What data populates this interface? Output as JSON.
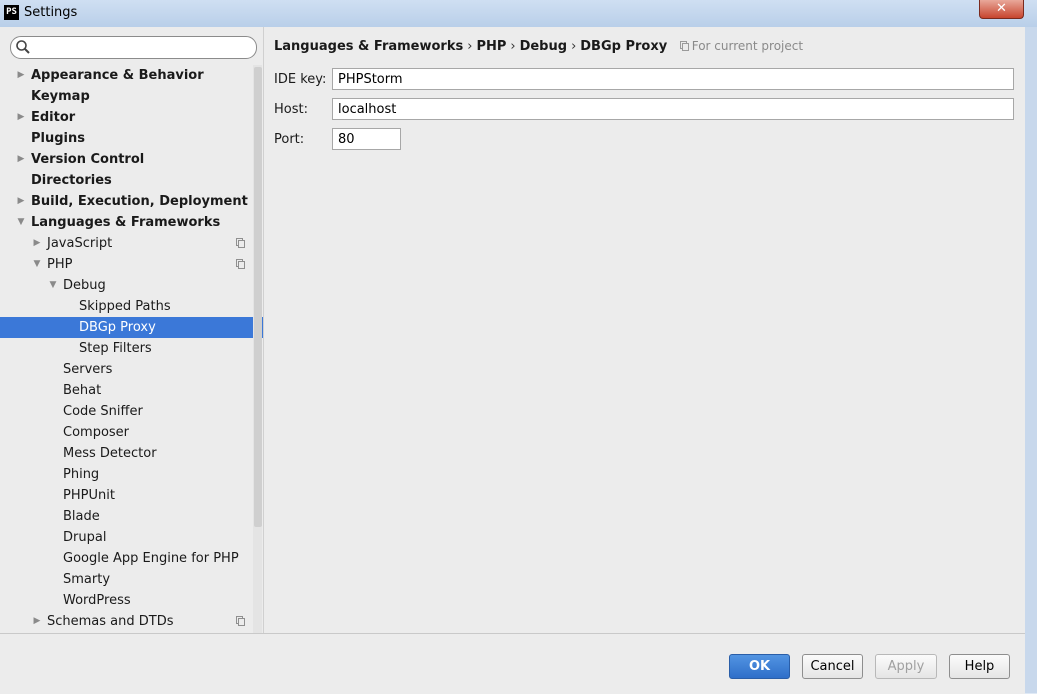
{
  "window": {
    "title": "Settings",
    "app_icon_text": "PS",
    "close_glyph": "✕"
  },
  "search": {
    "value": "",
    "placeholder": ""
  },
  "tree": [
    {
      "label": "Appearance & Behavior",
      "level": 0,
      "bold": true,
      "arrow": "right"
    },
    {
      "label": "Keymap",
      "level": 0,
      "bold": true,
      "arrow": ""
    },
    {
      "label": "Editor",
      "level": 0,
      "bold": true,
      "arrow": "right"
    },
    {
      "label": "Plugins",
      "level": 0,
      "bold": true,
      "arrow": ""
    },
    {
      "label": "Version Control",
      "level": 0,
      "bold": true,
      "arrow": "right"
    },
    {
      "label": "Directories",
      "level": 0,
      "bold": true,
      "arrow": ""
    },
    {
      "label": "Build, Execution, Deployment",
      "level": 0,
      "bold": true,
      "arrow": "right"
    },
    {
      "label": "Languages & Frameworks",
      "level": 0,
      "bold": true,
      "arrow": "down"
    },
    {
      "label": "JavaScript",
      "level": 1,
      "arrow": "right",
      "project": true
    },
    {
      "label": "PHP",
      "level": 1,
      "arrow": "down",
      "project": true
    },
    {
      "label": "Debug",
      "level": 2,
      "arrow": "down"
    },
    {
      "label": "Skipped Paths",
      "level": 3,
      "arrow": ""
    },
    {
      "label": "DBGp Proxy",
      "level": 3,
      "arrow": "",
      "selected": true
    },
    {
      "label": "Step Filters",
      "level": 3,
      "arrow": ""
    },
    {
      "label": "Servers",
      "level": 2,
      "arrow": ""
    },
    {
      "label": "Behat",
      "level": 2,
      "arrow": ""
    },
    {
      "label": "Code Sniffer",
      "level": 2,
      "arrow": ""
    },
    {
      "label": "Composer",
      "level": 2,
      "arrow": ""
    },
    {
      "label": "Mess Detector",
      "level": 2,
      "arrow": ""
    },
    {
      "label": "Phing",
      "level": 2,
      "arrow": ""
    },
    {
      "label": "PHPUnit",
      "level": 2,
      "arrow": ""
    },
    {
      "label": "Blade",
      "level": 2,
      "arrow": ""
    },
    {
      "label": "Drupal",
      "level": 2,
      "arrow": ""
    },
    {
      "label": "Google App Engine for PHP",
      "level": 2,
      "arrow": ""
    },
    {
      "label": "Smarty",
      "level": 2,
      "arrow": ""
    },
    {
      "label": "WordPress",
      "level": 2,
      "arrow": ""
    },
    {
      "label": "Schemas and DTDs",
      "level": 1,
      "arrow": "right",
      "project": true
    }
  ],
  "breadcrumb": {
    "items": [
      "Languages & Frameworks",
      "PHP",
      "Debug",
      "DBGp Proxy"
    ],
    "separator": "›",
    "scope": "For current project"
  },
  "form": {
    "ide_key": {
      "label": "IDE key:",
      "value": "PHPStorm"
    },
    "host": {
      "label": "Host:",
      "value": "localhost"
    },
    "port": {
      "label": "Port:",
      "value": "80"
    }
  },
  "buttons": {
    "ok": "OK",
    "cancel": "Cancel",
    "apply": "Apply",
    "help": "Help"
  }
}
